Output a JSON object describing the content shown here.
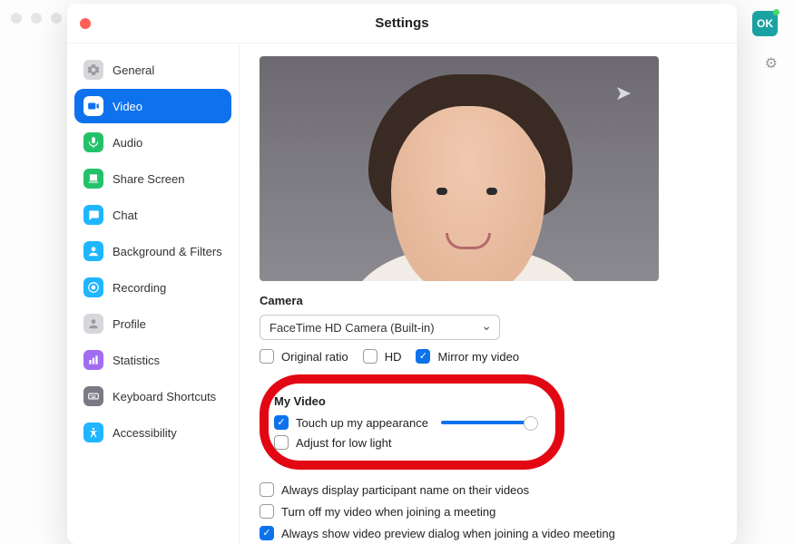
{
  "topbar": {
    "avatar_initials": "OK"
  },
  "panel": {
    "title": "Settings"
  },
  "sidebar": {
    "items": [
      {
        "label": "General",
        "icon": "gear-icon",
        "color": "#d7d7db",
        "active": false
      },
      {
        "label": "Video",
        "icon": "video-icon",
        "color": "#0e72ed",
        "active": true
      },
      {
        "label": "Audio",
        "icon": "audio-icon",
        "color": "#23c26a",
        "active": false
      },
      {
        "label": "Share Screen",
        "icon": "share-icon",
        "color": "#23c26a",
        "active": false
      },
      {
        "label": "Chat",
        "icon": "chat-icon",
        "color": "#1fb6ff",
        "active": false
      },
      {
        "label": "Background & Filters",
        "icon": "bgfilters-icon",
        "color": "#1fb6ff",
        "active": false
      },
      {
        "label": "Recording",
        "icon": "recording-icon",
        "color": "#1fb6ff",
        "active": false
      },
      {
        "label": "Profile",
        "icon": "profile-icon",
        "color": "#d7d7db",
        "active": false
      },
      {
        "label": "Statistics",
        "icon": "stats-icon",
        "color": "#a06cf0",
        "active": false
      },
      {
        "label": "Keyboard Shortcuts",
        "icon": "keyboard-icon",
        "color": "#7a7a85",
        "active": false
      },
      {
        "label": "Accessibility",
        "icon": "a11y-icon",
        "color": "#1fb6ff",
        "active": false
      }
    ]
  },
  "content": {
    "camera_label": "Camera",
    "camera_selected": "FaceTime HD Camera (Built-in)",
    "camera_row": {
      "original_ratio": {
        "label": "Original ratio",
        "checked": false
      },
      "hd": {
        "label": "HD",
        "checked": false
      },
      "mirror": {
        "label": "Mirror my video",
        "checked": true
      }
    },
    "my_video": {
      "title": "My Video",
      "touch_up": {
        "label": "Touch up my appearance",
        "checked": true,
        "slider_pct": 95
      },
      "low_light": {
        "label": "Adjust for low light",
        "checked": false
      }
    },
    "more": {
      "display_name": {
        "label": "Always display participant name on their videos",
        "checked": false
      },
      "turn_off_join": {
        "label": "Turn off my video when joining a meeting",
        "checked": false
      },
      "show_preview": {
        "label": "Always show video preview dialog when joining a video meeting",
        "checked": true
      }
    }
  }
}
